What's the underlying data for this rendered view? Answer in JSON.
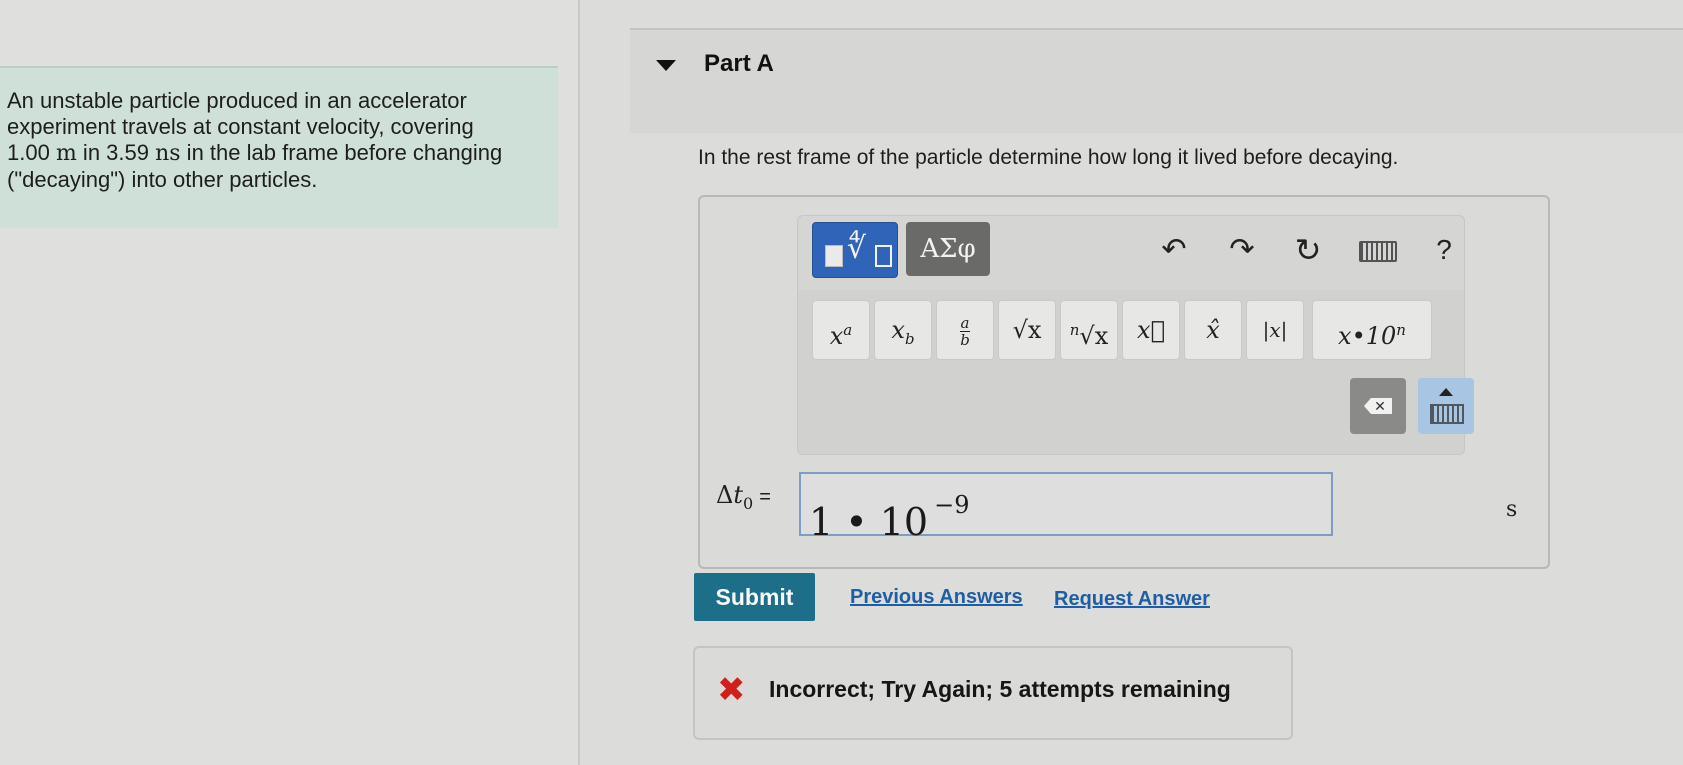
{
  "problem": {
    "line1": "An unstable particle produced in an accelerator",
    "line2": "experiment travels at constant velocity, covering",
    "line3_prefix": "1.00 ",
    "line3_unit1": "m",
    "line3_mid": " in 3.59 ",
    "line3_unit2": "ns",
    "line3_suffix": " in the lab frame before changing",
    "line4": "(\"decaying\") into other particles."
  },
  "part": {
    "title": "Part A"
  },
  "question": "In the rest frame of the particle determine how long it lived before decaying.",
  "toolbar": {
    "greek_label": "ΑΣφ",
    "undo_glyph": "↶",
    "redo_glyph": "↷",
    "reset_glyph": "↻",
    "help_label": "?",
    "icons": [
      "templates-icon",
      "undo-icon",
      "redo-icon",
      "reset-icon",
      "keyboard-icon",
      "help-icon",
      "delete-icon",
      "keyboard-toggle-icon"
    ]
  },
  "symbols": {
    "superscript": {
      "base": "x",
      "exp": "a"
    },
    "subscript": {
      "base": "x",
      "sub": "b"
    },
    "fraction": {
      "num": "a",
      "den": "b"
    },
    "sqrt": "√x",
    "nthroot_index": "n",
    "nthroot_body": "√x",
    "vector": "x⃗",
    "unit_vector": "x̂",
    "abs": "|x|",
    "sci_base": "x•10",
    "sci_exp": "n"
  },
  "answer": {
    "var_delta": "Δ",
    "var_t": "t",
    "var_sub": "0",
    "equals": "=",
    "value_main": "1 • 10",
    "value_exp": "−9",
    "unit": "s"
  },
  "actions": {
    "submit": "Submit",
    "previous_answers": "Previous Answers",
    "request_answer": "Request Answer"
  },
  "feedback": {
    "icon_glyph": "✖",
    "message": "Incorrect; Try Again; 5 attempts remaining"
  },
  "colors": {
    "problem_bg": "#cfe0d8",
    "submit_bg": "#1c6e89",
    "link": "#1f5ea4",
    "error": "#d0201e",
    "templates_btn": "#2f64b8"
  }
}
